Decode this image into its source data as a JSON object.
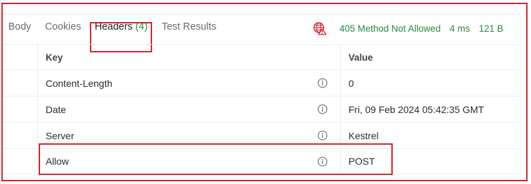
{
  "tabs": [
    {
      "label": "Body"
    },
    {
      "label": "Cookies"
    },
    {
      "label": "Headers",
      "count": "(4)",
      "active": true
    },
    {
      "label": "Test Results"
    }
  ],
  "response_status": {
    "status": "405 Method Not Allowed",
    "time": "4 ms",
    "size": "121 B",
    "status_color": "#268a3d",
    "icon": "globe-error-icon"
  },
  "headers_table": {
    "columns": {
      "key": "Key",
      "value": "Value"
    },
    "rows": [
      {
        "key": "Content-Length",
        "value": "0"
      },
      {
        "key": "Date",
        "value": "Fri, 09 Feb 2024 05:42:35 GMT"
      },
      {
        "key": "Server",
        "value": "Kestrel"
      },
      {
        "key": "Allow",
        "value": "POST"
      }
    ]
  },
  "highlight_color": "#d8232a"
}
